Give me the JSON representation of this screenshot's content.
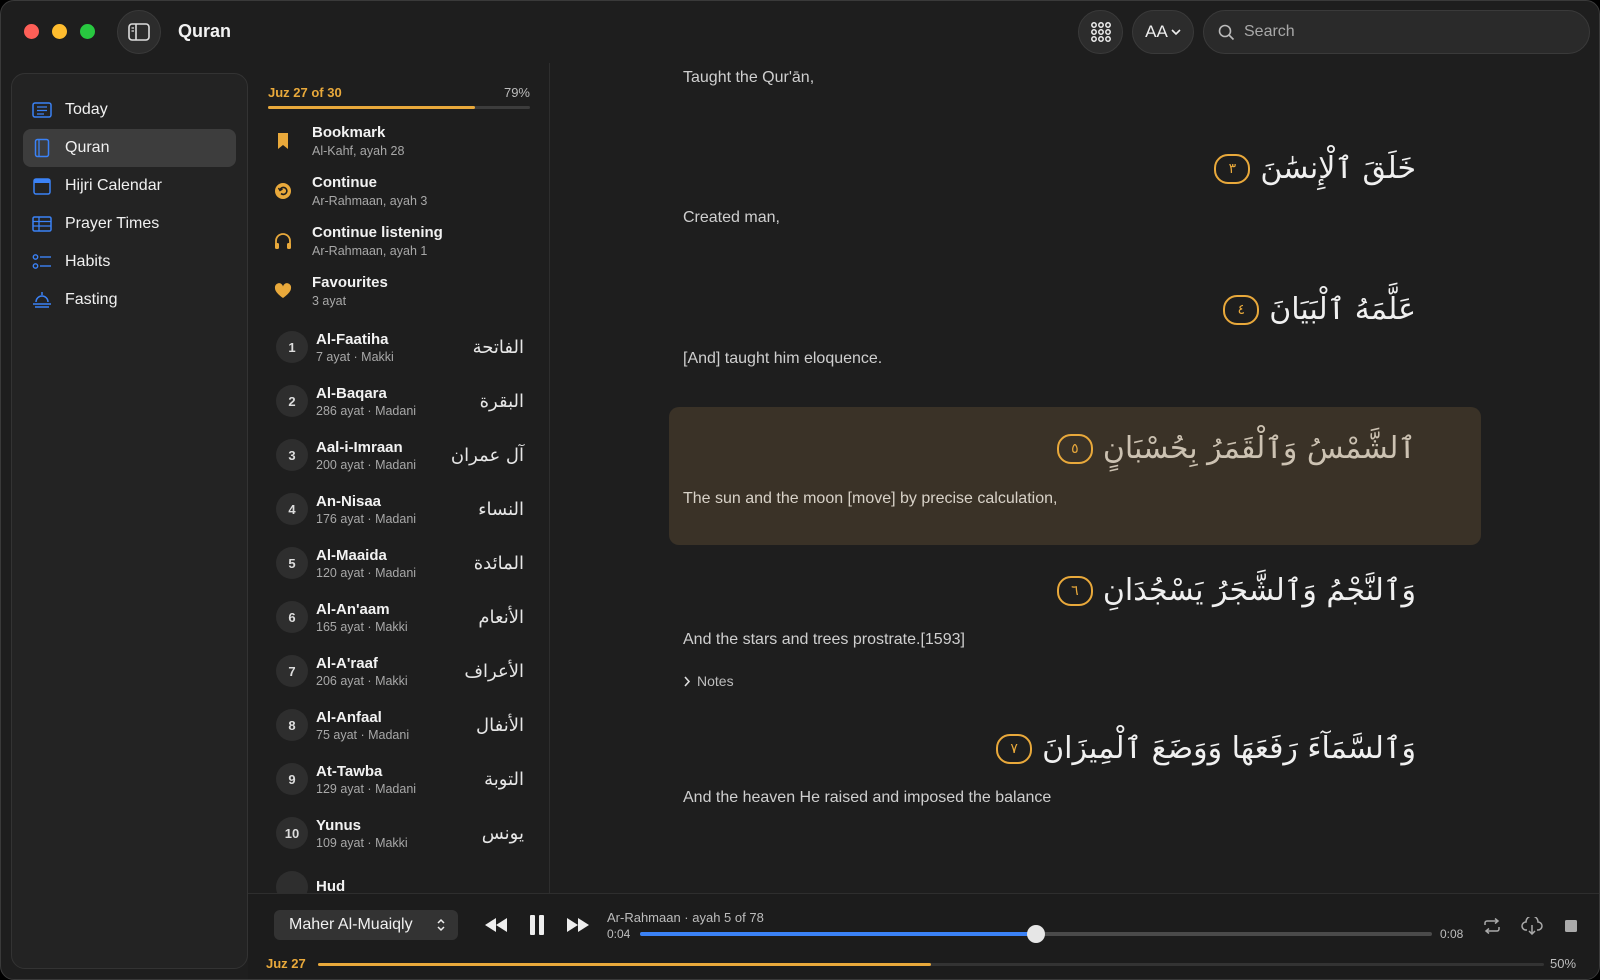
{
  "app": {
    "title": "Quran"
  },
  "toolbar": {
    "font_button_label": "AA",
    "search_placeholder": "Search"
  },
  "sidebar": {
    "items": [
      {
        "label": "Today",
        "icon": "list-icon"
      },
      {
        "label": "Quran",
        "icon": "book-icon",
        "active": true
      },
      {
        "label": "Hijri Calendar",
        "icon": "calendar-icon"
      },
      {
        "label": "Prayer Times",
        "icon": "table-icon"
      },
      {
        "label": "Habits",
        "icon": "checklist-icon"
      },
      {
        "label": "Fasting",
        "icon": "sunrise-icon"
      }
    ]
  },
  "list": {
    "juz_label": "Juz 27 of 30",
    "juz_percent": "79%",
    "juz_progress": 0.79,
    "quick": [
      {
        "title": "Bookmark",
        "subtitle": "Al-Kahf, ayah 28",
        "icon": "bookmark-icon"
      },
      {
        "title": "Continue",
        "subtitle": "Ar-Rahmaan, ayah 3",
        "icon": "continue-icon"
      },
      {
        "title": "Continue listening",
        "subtitle": "Ar-Rahmaan, ayah 1",
        "icon": "headphones-icon"
      },
      {
        "title": "Favourites",
        "subtitle": "3 ayat",
        "icon": "heart-icon"
      }
    ],
    "surahs": [
      {
        "num": "1",
        "name": "Al-Faatiha",
        "meta": "7 ayat · Makki",
        "arabic": "الفاتحة"
      },
      {
        "num": "2",
        "name": "Al-Baqara",
        "meta": "286 ayat · Madani",
        "arabic": "البقرة"
      },
      {
        "num": "3",
        "name": "Aal-i-Imraan",
        "meta": "200 ayat · Madani",
        "arabic": "آل عمران"
      },
      {
        "num": "4",
        "name": "An-Nisaa",
        "meta": "176 ayat · Madani",
        "arabic": "النساء"
      },
      {
        "num": "5",
        "name": "Al-Maaida",
        "meta": "120 ayat · Madani",
        "arabic": "المائدة"
      },
      {
        "num": "6",
        "name": "Al-An'aam",
        "meta": "165 ayat · Makki",
        "arabic": "الأنعام"
      },
      {
        "num": "7",
        "name": "Al-A'raaf",
        "meta": "206 ayat · Makki",
        "arabic": "الأعراف"
      },
      {
        "num": "8",
        "name": "Al-Anfaal",
        "meta": "75 ayat · Madani",
        "arabic": "الأنفال"
      },
      {
        "num": "9",
        "name": "At-Tawba",
        "meta": "129 ayat · Madani",
        "arabic": "التوبة"
      },
      {
        "num": "10",
        "name": "Yunus",
        "meta": "109 ayat · Makki",
        "arabic": "يونس"
      },
      {
        "num": "",
        "name": "Hud",
        "meta": "",
        "arabic": ""
      }
    ]
  },
  "reader": {
    "ayat": [
      {
        "translation": "Taught the Qur'ān,"
      },
      {
        "arabic": "خَلَقَ ٱلْإِنسَٰنَ",
        "marker": "٣",
        "translation": "Created man,"
      },
      {
        "arabic": "عَلَّمَهُ ٱلْبَيَانَ",
        "marker": "٤",
        "translation": "[And] taught him eloquence."
      },
      {
        "arabic": "ٱلشَّمْسُ وَٱلْقَمَرُ بِحُسْبَانٍ",
        "marker": "٥",
        "translation": "The sun and the moon [move] by precise calculation,",
        "highlighted": true
      },
      {
        "arabic": "وَٱلنَّجْمُ وَٱلشَّجَرُ يَسْجُدَانِ",
        "marker": "٦",
        "translation": "And the stars and trees prostrate.[1593]"
      },
      {
        "arabic": "وَٱلسَّمَآءَ رَفَعَهَا وَوَضَعَ ٱلْمِيزَانَ",
        "marker": "٧",
        "translation": "And the heaven He raised and imposed the balance"
      }
    ],
    "notes_label": "Notes"
  },
  "player": {
    "reciter": "Maher Al-Muaiqly",
    "now_playing": "Ar-Rahmaan · ayah 5 of 78",
    "current_time": "0:04",
    "total_time": "0:08",
    "seek_fraction": 0.5,
    "juz_label": "Juz 27",
    "juz_percent": "50%",
    "juz_progress": 0.5
  },
  "colors": {
    "accent": "#e9a93b",
    "seek": "#3b82f6",
    "highlight_bg": "#3a3227"
  }
}
